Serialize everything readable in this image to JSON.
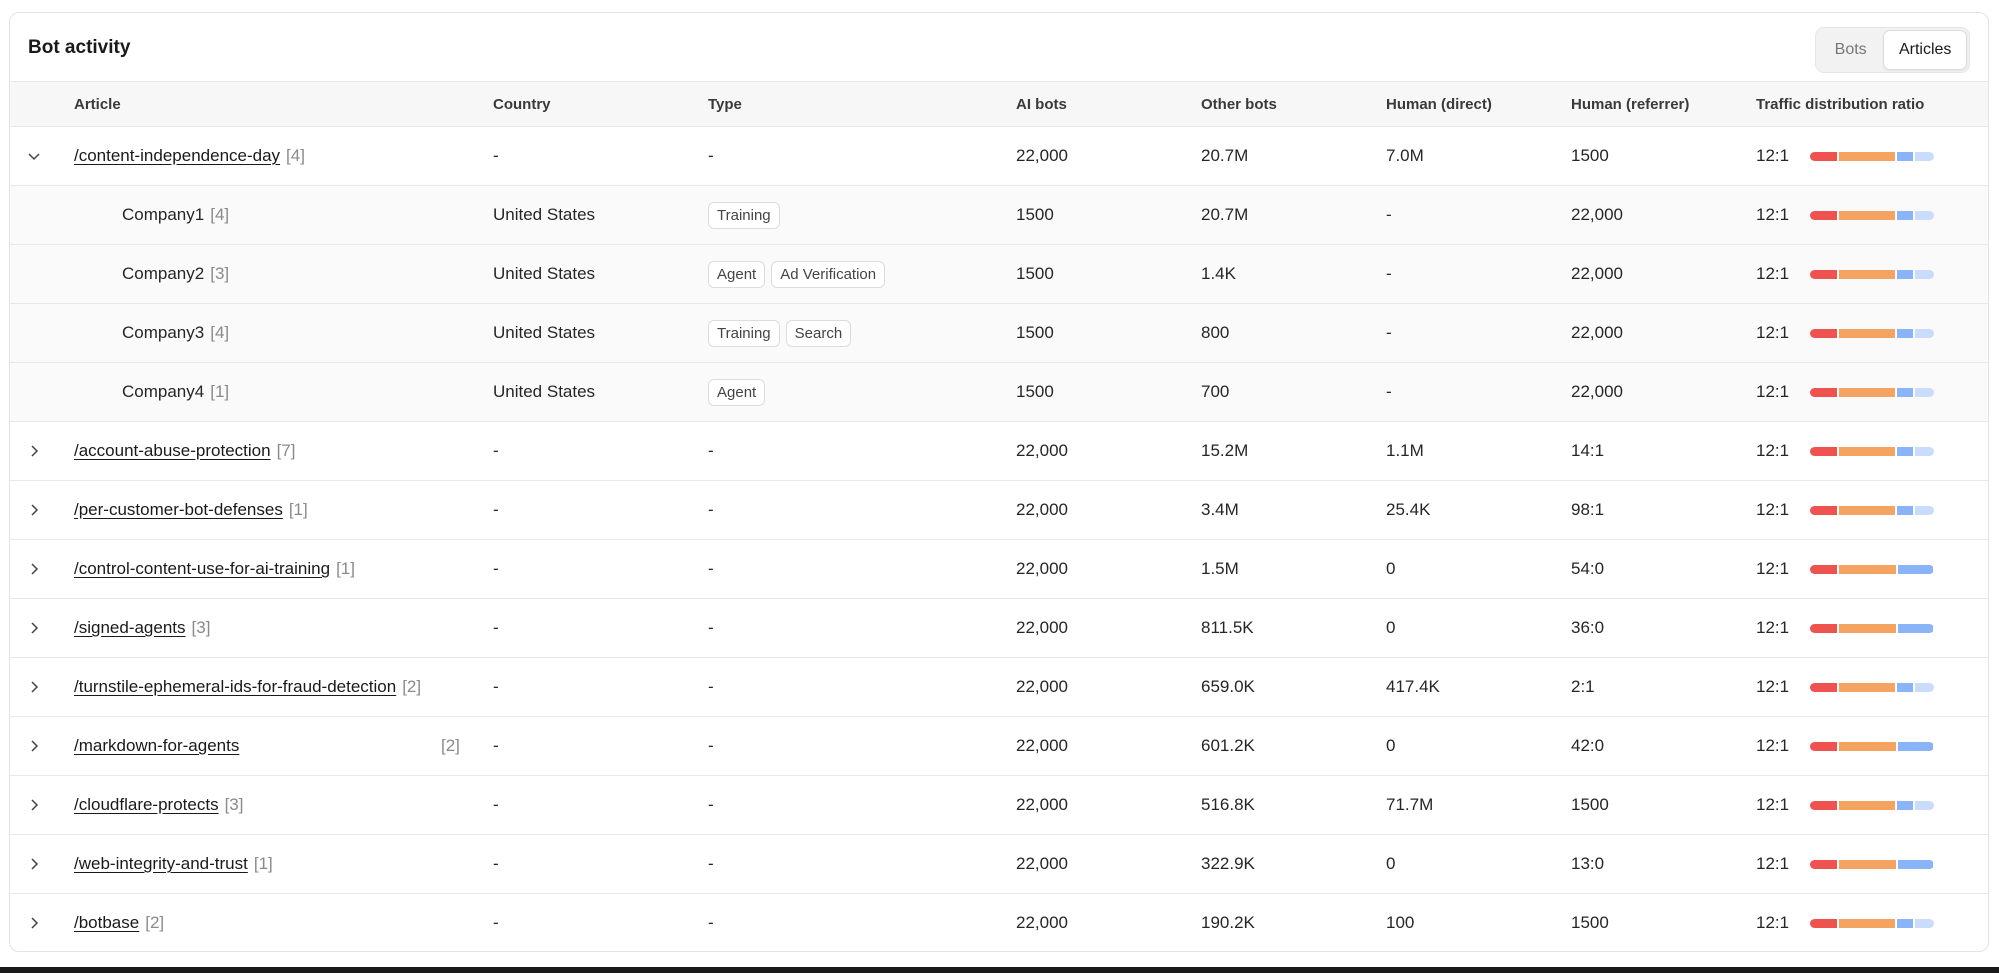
{
  "title": "Bot activity",
  "toggle": {
    "bots": "Bots",
    "articles": "Articles",
    "active": "Articles"
  },
  "columns": {
    "article": "Article",
    "country": "Country",
    "type": "Type",
    "ai_bots": "AI bots",
    "other_bots": "Other bots",
    "human_direct": "Human (direct)",
    "human_referrer": "Human (referrer)",
    "ratio": "Traffic distribution ratio"
  },
  "colors": {
    "red": "#ef5350",
    "orange": "#f4a460",
    "blue": "#8ab4f8",
    "light_blue": "#c9dcfb"
  },
  "rows": [
    {
      "expanded": true,
      "article": "/content-independence-day",
      "count": "[4]",
      "country": "-",
      "type": "-",
      "ai_bots": "22,000",
      "other_bots": "20.7M",
      "human_direct": "7.0M",
      "human_referrer": "1500",
      "ratio": "12:1",
      "bar": [
        0.2,
        0.42,
        0.12,
        0.14
      ]
    },
    {
      "child": true,
      "article": "Company1",
      "count": "[4]",
      "country": "United States",
      "tags": [
        "Training"
      ],
      "ai_bots": "1500",
      "other_bots": "20.7M",
      "human_direct": "-",
      "human_referrer": "22,000",
      "ratio": "12:1",
      "bar": [
        0.2,
        0.42,
        0.12,
        0.14
      ]
    },
    {
      "child": true,
      "article": "Company2",
      "count": "[3]",
      "country": "United States",
      "tags": [
        "Agent",
        "Ad Verification"
      ],
      "ai_bots": "1500",
      "other_bots": "1.4K",
      "human_direct": "-",
      "human_referrer": "22,000",
      "ratio": "12:1",
      "bar": [
        0.2,
        0.42,
        0.12,
        0.14
      ]
    },
    {
      "child": true,
      "article": "Company3",
      "count": "[4]",
      "country": "United States",
      "tags": [
        "Training",
        "Search"
      ],
      "ai_bots": "1500",
      "other_bots": "800",
      "human_direct": "-",
      "human_referrer": "22,000",
      "ratio": "12:1",
      "bar": [
        0.2,
        0.42,
        0.12,
        0.14
      ]
    },
    {
      "child": true,
      "article": "Company4",
      "count": "[1]",
      "country": "United States",
      "tags": [
        "Agent"
      ],
      "ai_bots": "1500",
      "other_bots": "700",
      "human_direct": "-",
      "human_referrer": "22,000",
      "ratio": "12:1",
      "bar": [
        0.2,
        0.42,
        0.12,
        0.14
      ]
    },
    {
      "article": "/account-abuse-protection",
      "count": "[7]",
      "country": "-",
      "type": "-",
      "ai_bots": "22,000",
      "other_bots": "15.2M",
      "human_direct": "1.1M",
      "human_referrer": "14:1",
      "ratio": "12:1",
      "bar": [
        0.2,
        0.42,
        0.12,
        0.14
      ]
    },
    {
      "article": "/per-customer-bot-defenses",
      "count": "[1]",
      "country": "-",
      "type": "-",
      "ai_bots": "22,000",
      "other_bots": "3.4M",
      "human_direct": "25.4K",
      "human_referrer": "98:1",
      "ratio": "12:1",
      "bar": [
        0.2,
        0.42,
        0.12,
        0.14
      ]
    },
    {
      "article": "/control-content-use-for-ai-training",
      "count": "[1]",
      "country": "-",
      "type": "-",
      "ai_bots": "22,000",
      "other_bots": "1.5M",
      "human_direct": "0",
      "human_referrer": "54:0",
      "ratio": "12:1",
      "bar": [
        0.2,
        0.42,
        0.26,
        0
      ]
    },
    {
      "article": "/signed-agents",
      "count": "[3]",
      "country": "-",
      "type": "-",
      "ai_bots": "22,000",
      "other_bots": "811.5K",
      "human_direct": "0",
      "human_referrer": "36:0",
      "ratio": "12:1",
      "bar": [
        0.2,
        0.42,
        0.26,
        0
      ]
    },
    {
      "article": "/turnstile-ephemeral-ids-for-fraud-detection",
      "count": "[2]",
      "country": "-",
      "type": "-",
      "ai_bots": "22,000",
      "other_bots": "659.0K",
      "human_direct": "417.4K",
      "human_referrer": "2:1",
      "ratio": "12:1",
      "bar": [
        0.2,
        0.42,
        0.12,
        0.14
      ]
    },
    {
      "article": "/markdown-for-agents",
      "count": "[2]",
      "count_far": true,
      "country": "-",
      "type": "-",
      "ai_bots": "22,000",
      "other_bots": "601.2K",
      "human_direct": "0",
      "human_referrer": "42:0",
      "ratio": "12:1",
      "bar": [
        0.2,
        0.42,
        0.26,
        0
      ]
    },
    {
      "article": "/cloudflare-protects",
      "count": "[3]",
      "country": "-",
      "type": "-",
      "ai_bots": "22,000",
      "other_bots": "516.8K",
      "human_direct": "71.7M",
      "human_referrer": "1500",
      "ratio": "12:1",
      "bar": [
        0.2,
        0.42,
        0.12,
        0.14
      ]
    },
    {
      "article": "/web-integrity-and-trust",
      "count": "[1]",
      "country": "-",
      "type": "-",
      "ai_bots": "22,000",
      "other_bots": "322.9K",
      "human_direct": "0",
      "human_referrer": "13:0",
      "ratio": "12:1",
      "bar": [
        0.2,
        0.42,
        0.26,
        0
      ]
    },
    {
      "article": "/botbase",
      "count": "[2]",
      "country": "-",
      "type": "-",
      "ai_bots": "22,000",
      "other_bots": "190.2K",
      "human_direct": "100",
      "human_referrer": "1500",
      "ratio": "12:1",
      "bar": [
        0.2,
        0.42,
        0.12,
        0.14
      ]
    }
  ]
}
